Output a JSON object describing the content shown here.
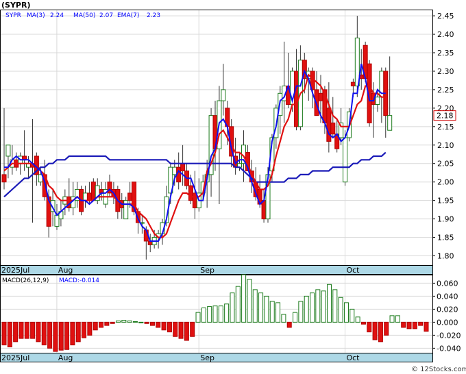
{
  "chart_data": [
    {
      "type": "candlestick",
      "title": "(SYPR)",
      "legend": [
        {
          "label": "SYPR",
          "color": "#0000ff"
        },
        {
          "label": "MA(3)",
          "value": "2.24",
          "color": "#0000ff"
        },
        {
          "label": "MA(50)",
          "value": "2.07",
          "color": "#0000ff"
        },
        {
          "label": "EMA(7)",
          "value": "2.23",
          "color": "#0000ff"
        }
      ],
      "last_price_label": "2.18",
      "last_price": 2.18,
      "ylim": [
        1.775,
        2.465
      ],
      "y_ticks": [
        "2.45",
        "2.40",
        "2.35",
        "2.30",
        "2.25",
        "2.20",
        "2.15",
        "2.10",
        "2.05",
        "2.00",
        "1.95",
        "1.90",
        "1.85",
        "1.80"
      ],
      "x_labels": [
        {
          "label": "2025Jul",
          "i": 0
        },
        {
          "label": "Aug",
          "i": 14
        },
        {
          "label": "Sep",
          "i": 49
        },
        {
          "label": "Oct",
          "i": 85
        }
      ],
      "n_slots": 105,
      "candles": [
        {
          "o": 2.02,
          "h": 2.2,
          "l": 1.98,
          "c": 2.0
        },
        {
          "o": 2.07,
          "h": 2.1,
          "l": 2.01,
          "c": 2.1
        },
        {
          "o": 2.04,
          "h": 2.1,
          "l": 2.02,
          "c": 2.06
        },
        {
          "o": 2.06,
          "h": 2.08,
          "l": 2.03,
          "c": 2.04
        },
        {
          "o": 2.05,
          "h": 2.08,
          "l": 2.02,
          "c": 2.07
        },
        {
          "o": 2.07,
          "h": 2.14,
          "l": 2.03,
          "c": 2.06
        },
        {
          "o": 2.04,
          "h": 2.07,
          "l": 2.01,
          "c": 2.05
        },
        {
          "o": 2.05,
          "h": 2.17,
          "l": 1.89,
          "c": 2.04
        },
        {
          "o": 2.07,
          "h": 2.08,
          "l": 1.99,
          "c": 2.02
        },
        {
          "o": 2.0,
          "h": 2.04,
          "l": 1.99,
          "c": 2.02
        },
        {
          "o": 2.02,
          "h": 2.06,
          "l": 1.95,
          "c": 1.96
        },
        {
          "o": 1.96,
          "h": 1.98,
          "l": 1.85,
          "c": 1.88
        },
        {
          "o": 1.92,
          "h": 1.98,
          "l": 1.88,
          "c": 1.95
        },
        {
          "o": 1.88,
          "h": 1.94,
          "l": 1.87,
          "c": 1.91
        },
        {
          "o": 1.9,
          "h": 1.95,
          "l": 1.88,
          "c": 1.92
        },
        {
          "o": 1.94,
          "h": 1.98,
          "l": 1.91,
          "c": 1.96
        }
      ],
      "candles_2": [
        {
          "o": 1.96,
          "h": 2.01,
          "l": 1.92,
          "c": 1.93
        },
        {
          "o": 1.93,
          "h": 2.0,
          "l": 1.91,
          "c": 1.96
        },
        {
          "o": 1.95,
          "h": 2.0,
          "l": 1.93,
          "c": 1.98
        },
        {
          "o": 1.98,
          "h": 1.99,
          "l": 1.91,
          "c": 1.92
        },
        {
          "o": 1.95,
          "h": 1.99,
          "l": 1.93,
          "c": 1.97
        },
        {
          "o": 1.97,
          "h": 2.0,
          "l": 1.94,
          "c": 1.95
        },
        {
          "o": 2.0,
          "h": 2.01,
          "l": 1.95,
          "c": 1.95
        },
        {
          "o": 1.95,
          "h": 2.01,
          "l": 1.94,
          "c": 1.99
        },
        {
          "o": 1.98,
          "h": 2.0,
          "l": 1.95,
          "c": 1.97
        },
        {
          "o": 1.94,
          "h": 2.0,
          "l": 1.93,
          "c": 1.98
        },
        {
          "o": 2.0,
          "h": 2.02,
          "l": 1.96,
          "c": 1.97
        },
        {
          "o": 1.98,
          "h": 2.0,
          "l": 1.94,
          "c": 1.96
        },
        {
          "o": 1.98,
          "h": 1.99,
          "l": 1.9,
          "c": 1.92
        },
        {
          "o": 1.95,
          "h": 1.97,
          "l": 1.9,
          "c": 1.93
        },
        {
          "o": 1.9,
          "h": 1.96,
          "l": 1.9,
          "c": 1.95
        },
        {
          "o": 1.97,
          "h": 2.0,
          "l": 1.93,
          "c": 1.95
        },
        {
          "o": 2.0,
          "h": 2.0,
          "l": 1.91,
          "c": 1.92
        }
      ],
      "candles_3": [
        {
          "o": 1.92,
          "h": 1.93,
          "l": 1.86,
          "c": 1.89
        },
        {
          "o": 1.89,
          "h": 1.91,
          "l": 1.86,
          "c": 1.89
        },
        {
          "o": 1.87,
          "h": 1.88,
          "l": 1.79,
          "c": 1.84
        },
        {
          "o": 1.84,
          "h": 1.86,
          "l": 1.81,
          "c": 1.83
        },
        {
          "o": 1.83,
          "h": 1.87,
          "l": 1.82,
          "c": 1.85
        },
        {
          "o": 1.85,
          "h": 1.87,
          "l": 1.82,
          "c": 1.86
        },
        {
          "o": 1.86,
          "h": 1.9,
          "l": 1.83,
          "c": 1.89
        },
        {
          "o": 1.89,
          "h": 1.99,
          "l": 1.88,
          "c": 1.96
        },
        {
          "o": 1.97,
          "h": 2.05,
          "l": 1.94,
          "c": 2.04
        },
        {
          "o": 2.02,
          "h": 2.06,
          "l": 1.99,
          "c": 2.04
        },
        {
          "o": 2.04,
          "h": 2.08,
          "l": 1.98,
          "c": 2.0
        },
        {
          "o": 2.05,
          "h": 2.1,
          "l": 1.99,
          "c": 2.03
        },
        {
          "o": 2.03,
          "h": 2.05,
          "l": 1.98,
          "c": 1.99
        },
        {
          "o": 1.99,
          "h": 2.02,
          "l": 1.94,
          "c": 1.95
        },
        {
          "o": 1.97,
          "h": 2.03,
          "l": 1.9,
          "c": 1.93
        },
        {
          "o": 1.93,
          "h": 2.01,
          "l": 1.92,
          "c": 1.97
        },
        {
          "o": 1.97,
          "h": 2.02,
          "l": 1.95,
          "c": 2.0
        }
      ],
      "candles_4": [
        {
          "o": 2.0,
          "h": 2.06,
          "l": 1.93,
          "c": 2.02
        },
        {
          "o": 2.02,
          "h": 2.2,
          "l": 1.96,
          "c": 2.18
        },
        {
          "o": 2.18,
          "h": 2.22,
          "l": 2.03,
          "c": 2.09
        },
        {
          "o": 2.09,
          "h": 2.26,
          "l": 1.94,
          "c": 2.22
        },
        {
          "o": 2.22,
          "h": 2.32,
          "l": 2.18,
          "c": 2.25
        },
        {
          "o": 2.2,
          "h": 2.22,
          "l": 2.1,
          "c": 2.15
        },
        {
          "o": 2.15,
          "h": 2.17,
          "l": 2.04,
          "c": 2.07
        },
        {
          "o": 2.07,
          "h": 2.12,
          "l": 2.02,
          "c": 2.04
        },
        {
          "o": 2.04,
          "h": 2.08,
          "l": 2.03,
          "c": 2.05
        },
        {
          "o": 2.05,
          "h": 2.14,
          "l": 2.0,
          "c": 2.1
        },
        {
          "o": 2.08,
          "h": 2.1,
          "l": 2.03,
          "c": 2.03
        },
        {
          "o": 2.03,
          "h": 2.06,
          "l": 1.97,
          "c": 2.0
        },
        {
          "o": 2.0,
          "h": 2.04,
          "l": 1.95,
          "c": 1.96
        },
        {
          "o": 1.98,
          "h": 2.02,
          "l": 1.93,
          "c": 1.94
        },
        {
          "o": 1.95,
          "h": 1.98,
          "l": 1.89,
          "c": 1.9
        },
        {
          "o": 1.9,
          "h": 2.04,
          "l": 1.89,
          "c": 2.02
        },
        {
          "o": 2.03,
          "h": 2.13,
          "l": 2.0,
          "c": 2.12
        },
        {
          "o": 2.12,
          "h": 2.21,
          "l": 2.09,
          "c": 2.2
        }
      ],
      "candles_5": [
        {
          "o": 2.18,
          "h": 2.26,
          "l": 2.13,
          "c": 2.24
        },
        {
          "o": 2.22,
          "h": 2.38,
          "l": 2.16,
          "c": 2.26
        },
        {
          "o": 2.26,
          "h": 2.35,
          "l": 2.2,
          "c": 2.21
        },
        {
          "o": 2.21,
          "h": 2.31,
          "l": 2.19,
          "c": 2.3
        },
        {
          "o": 2.3,
          "h": 2.36,
          "l": 2.14,
          "c": 2.15
        },
        {
          "o": 2.15,
          "h": 2.37,
          "l": 2.14,
          "c": 2.33
        },
        {
          "o": 2.33,
          "h": 2.35,
          "l": 2.24,
          "c": 2.28
        },
        {
          "o": 2.28,
          "h": 2.31,
          "l": 2.22,
          "c": 2.3
        },
        {
          "o": 2.3,
          "h": 2.31,
          "l": 2.2,
          "c": 2.25
        },
        {
          "o": 2.25,
          "h": 2.3,
          "l": 2.19,
          "c": 2.18
        },
        {
          "o": 2.24,
          "h": 2.29,
          "l": 2.16,
          "c": 2.22
        },
        {
          "o": 2.25,
          "h": 2.26,
          "l": 2.13,
          "c": 2.16
        },
        {
          "o": 2.2,
          "h": 2.27,
          "l": 2.08,
          "c": 2.11
        },
        {
          "o": 2.16,
          "h": 2.23,
          "l": 2.12,
          "c": 2.13
        },
        {
          "o": 2.13,
          "h": 2.17,
          "l": 2.08,
          "c": 2.09
        },
        {
          "o": 2.12,
          "h": 2.2,
          "l": 2.1,
          "c": 2.16
        },
        {
          "o": 2.0,
          "h": 2.14,
          "l": 1.99,
          "c": 2.12
        },
        {
          "o": 2.12,
          "h": 2.2,
          "l": 2.11,
          "c": 2.19
        }
      ],
      "candles_6": [
        {
          "o": 2.27,
          "h": 2.28,
          "l": 2.23,
          "c": 2.26
        },
        {
          "o": 2.26,
          "h": 2.45,
          "l": 2.23,
          "c": 2.39
        },
        {
          "o": 2.29,
          "h": 2.36,
          "l": 2.25,
          "c": 2.28
        },
        {
          "o": 2.37,
          "h": 2.38,
          "l": 2.27,
          "c": 2.28
        },
        {
          "o": 2.32,
          "h": 2.33,
          "l": 2.15,
          "c": 2.16
        },
        {
          "o": 2.24,
          "h": 2.27,
          "l": 2.12,
          "c": 2.21
        },
        {
          "o": 2.21,
          "h": 2.25,
          "l": 2.19,
          "c": 2.23
        },
        {
          "o": 2.23,
          "h": 2.31,
          "l": 2.16,
          "c": 2.3
        },
        {
          "o": 2.3,
          "h": 2.31,
          "l": 2.12,
          "c": 2.18
        },
        {
          "o": 2.14,
          "h": 2.34,
          "l": 2.14,
          "c": 2.18
        }
      ],
      "ema7": [
        2.03,
        2.04,
        2.05,
        2.05,
        2.05,
        2.05,
        2.05,
        2.05,
        2.04,
        2.03,
        2.02,
        1.99,
        1.98,
        1.96,
        1.95,
        1.95,
        1.95,
        1.95,
        1.96,
        1.95,
        1.95,
        1.95,
        1.95,
        1.96,
        1.96,
        1.96,
        1.96,
        1.96,
        1.95,
        1.94,
        1.94,
        1.94,
        1.94,
        1.92,
        1.91,
        1.9,
        1.88,
        1.86,
        1.85,
        1.85,
        1.86,
        1.89,
        1.92,
        1.95,
        1.97,
        1.97,
        1.96,
        1.96,
        1.96,
        1.97,
        2.03,
        2.05,
        2.08,
        2.13,
        2.14,
        2.12,
        2.1,
        2.08,
        2.08,
        2.07,
        2.05,
        2.02,
        2.0,
        1.98,
        1.98,
        1.99,
        2.02,
        2.07,
        2.11,
        2.15,
        2.17,
        2.21,
        2.21,
        2.24,
        2.25,
        2.29,
        2.28,
        2.27,
        2.26,
        2.24,
        2.21,
        2.18,
        2.17,
        2.15,
        2.15,
        2.15,
        2.18,
        2.21,
        2.22,
        2.26,
        2.26,
        2.24,
        2.24,
        2.23,
        2.23
      ],
      "ma3": [
        2.04,
        2.04,
        2.06,
        2.07,
        2.06,
        2.06,
        2.06,
        2.05,
        2.04,
        2.03,
        2.0,
        1.95,
        1.93,
        1.91,
        1.92,
        1.93,
        1.94,
        1.95,
        1.96,
        1.95,
        1.95,
        1.94,
        1.95,
        1.96,
        1.97,
        1.97,
        1.98,
        1.97,
        1.95,
        1.94,
        1.94,
        1.94,
        1.93,
        1.9,
        1.88,
        1.87,
        1.84,
        1.84,
        1.84,
        1.86,
        1.9,
        1.96,
        2.01,
        2.03,
        2.02,
        2.01,
        2.01,
        1.98,
        1.95,
        1.95,
        2.01,
        2.07,
        2.09,
        2.16,
        2.17,
        2.15,
        2.09,
        2.05,
        2.06,
        2.06,
        2.04,
        2.0,
        1.97,
        1.94,
        1.95,
        2.01,
        2.11,
        2.15,
        2.22,
        2.23,
        2.26,
        2.22,
        2.26,
        2.26,
        2.3,
        2.28,
        2.24,
        2.21,
        2.18,
        2.16,
        2.13,
        2.12,
        2.13,
        2.11,
        2.12,
        2.15,
        2.24,
        2.24,
        2.32,
        2.28,
        2.22,
        2.22,
        2.25,
        2.24,
        2.24
      ],
      "ma50": [
        1.96,
        1.97,
        1.98,
        1.99,
        2.0,
        2.01,
        2.01,
        2.02,
        2.03,
        2.04,
        2.04,
        2.05,
        2.05,
        2.06,
        2.06,
        2.06,
        2.07,
        2.07,
        2.07,
        2.07,
        2.07,
        2.07,
        2.07,
        2.07,
        2.07,
        2.07,
        2.06,
        2.06,
        2.06,
        2.06,
        2.06,
        2.06,
        2.06,
        2.06,
        2.06,
        2.06,
        2.06,
        2.06,
        2.06,
        2.06,
        2.06,
        2.05,
        2.05,
        2.05,
        2.05,
        2.05,
        2.05,
        2.05,
        2.05,
        2.05,
        2.05,
        2.05,
        2.05,
        2.05,
        2.05,
        2.05,
        2.05,
        2.04,
        2.04,
        2.03,
        2.02,
        2.01,
        2.0,
        2.0,
        2.0,
        2.0,
        2.0,
        2.0,
        2.0,
        2.0,
        2.01,
        2.01,
        2.01,
        2.02,
        2.02,
        2.02,
        2.03,
        2.03,
        2.03,
        2.03,
        2.03,
        2.04,
        2.04,
        2.04,
        2.04,
        2.04,
        2.05,
        2.05,
        2.06,
        2.06,
        2.06,
        2.07,
        2.07,
        2.07,
        2.08
      ]
    },
    {
      "type": "bar",
      "title": "MACD(26,12,9)",
      "value_label": "MACD:-0.014",
      "ylim": [
        -0.047,
        0.072
      ],
      "y_ticks": [
        "0.060",
        "0.040",
        "0.020",
        "0.000",
        "-0.020",
        "-0.040"
      ],
      "x_labels": [
        {
          "label": "2025Jul",
          "i": 0
        },
        {
          "label": "Aug",
          "i": 14
        },
        {
          "label": "Sep",
          "i": 49
        },
        {
          "label": "Oct",
          "i": 85
        }
      ],
      "values": [
        -0.035,
        -0.038,
        -0.03,
        -0.025,
        -0.025,
        -0.025,
        -0.03,
        -0.035,
        -0.04,
        -0.045,
        -0.043,
        -0.042,
        -0.035,
        -0.03,
        -0.024,
        -0.02,
        -0.012,
        -0.008,
        -0.005,
        -0.002,
        0.002,
        0.003,
        0.002,
        0.001,
        0.0,
        -0.002,
        -0.005,
        -0.008,
        -0.012,
        -0.015,
        -0.022,
        -0.025,
        -0.028,
        -0.022,
        0.015,
        0.022,
        0.024,
        0.025,
        0.025,
        0.028,
        0.045,
        0.055,
        0.073,
        0.066,
        0.05,
        0.045,
        0.04,
        0.032,
        0.03,
        0.012,
        -0.008,
        0.015,
        0.032,
        0.04,
        0.045,
        0.05,
        0.048,
        0.058,
        0.05,
        0.038,
        0.03,
        0.02,
        0.008,
        -0.003,
        -0.015,
        -0.027,
        -0.03,
        -0.02,
        0.01,
        0.01,
        -0.008,
        -0.01,
        -0.01,
        -0.005,
        -0.014
      ]
    }
  ],
  "watermark": "© 12Stocks.com"
}
